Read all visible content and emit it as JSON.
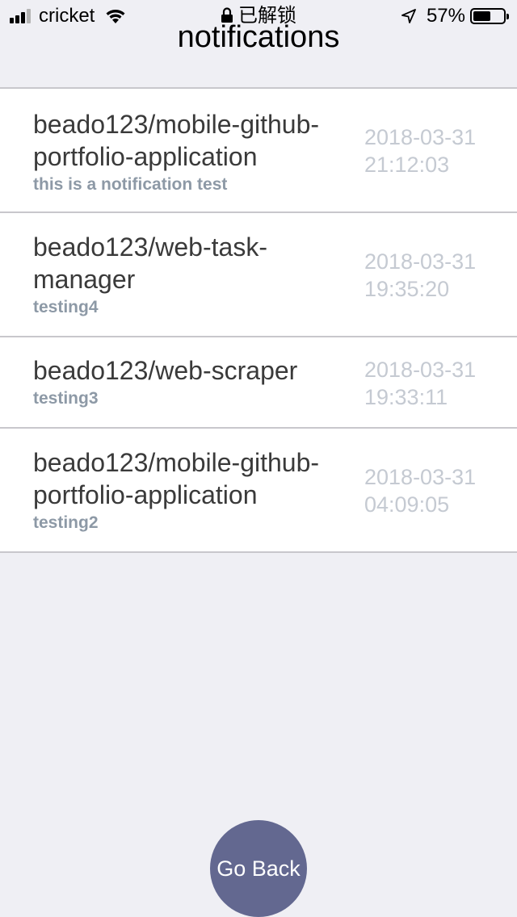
{
  "status_bar": {
    "carrier": "cricket",
    "lock_text": "已解锁",
    "battery_percent": "57%",
    "battery_level": 0.57,
    "signal_bars_active": 3,
    "signal_bars_total": 4,
    "icons": [
      "signal-icon",
      "wifi-icon",
      "lock-icon",
      "location-arrow-icon",
      "battery-icon"
    ]
  },
  "nav": {
    "title": "notifications"
  },
  "notifications": [
    {
      "repo": "beado123/mobile-github-portfolio-application",
      "message": "this is a notification test",
      "date": "2018-03-31",
      "time": "21:12:03"
    },
    {
      "repo": "beado123/web-task-manager",
      "message": "testing4",
      "date": "2018-03-31",
      "time": "19:35:20"
    },
    {
      "repo": "beado123/web-scraper",
      "message": "testing3",
      "date": "2018-03-31",
      "time": "19:33:11"
    },
    {
      "repo": "beado123/mobile-github-portfolio-application",
      "message": "testing2",
      "date": "2018-03-31",
      "time": "04:09:05"
    }
  ],
  "go_back": {
    "label": "Go Back"
  },
  "colors": {
    "background": "#efeff4",
    "row_background": "#ffffff",
    "separator": "#c8c7cc",
    "title_text": "#3a3a3a",
    "subtitle_text": "#8d99a6",
    "time_text": "#c5cad2",
    "button": "#636890"
  }
}
